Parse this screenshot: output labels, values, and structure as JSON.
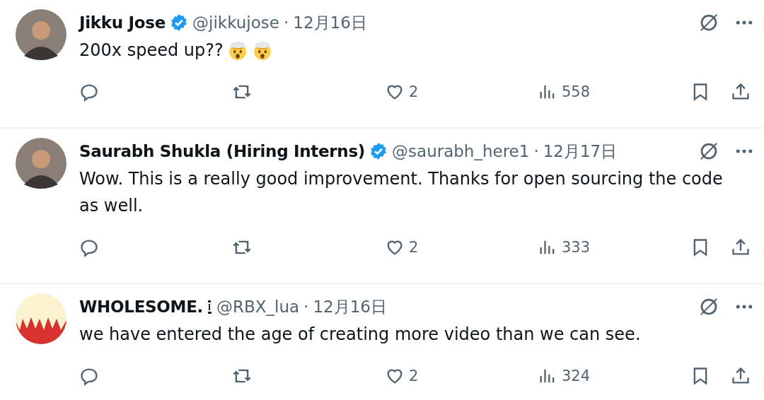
{
  "tweets": [
    {
      "avatar": {
        "kind": "photo"
      },
      "name": "Jikku Jose",
      "verified": true,
      "name_icon": false,
      "handle": "@jikkujose",
      "separator": "·",
      "date": "12月16日",
      "text": "200x speed up??",
      "emojis": [
        {
          "kind": "exploding-head"
        },
        {
          "kind": "exploding-head"
        }
      ],
      "likes": "2",
      "views": "558"
    },
    {
      "avatar": {
        "kind": "photo"
      },
      "name": "Saurabh Shukla (Hiring Interns)",
      "verified": true,
      "name_icon": false,
      "handle": "@saurabh_here1",
      "separator": "·",
      "date": "12月17日",
      "text": "Wow. This is a really good improvement. Thanks for open sourcing the code as well.",
      "likes": "2",
      "views": "333"
    },
    {
      "avatar": {
        "kind": "logo"
      },
      "name": "WHOLESOME.",
      "verified": false,
      "name_icon": true,
      "handle": "@RBX_lua",
      "separator": "·",
      "date": "12月16日",
      "text": "we have entered the age of creating more video than we can see.",
      "likes": "2",
      "views": "324"
    }
  ]
}
